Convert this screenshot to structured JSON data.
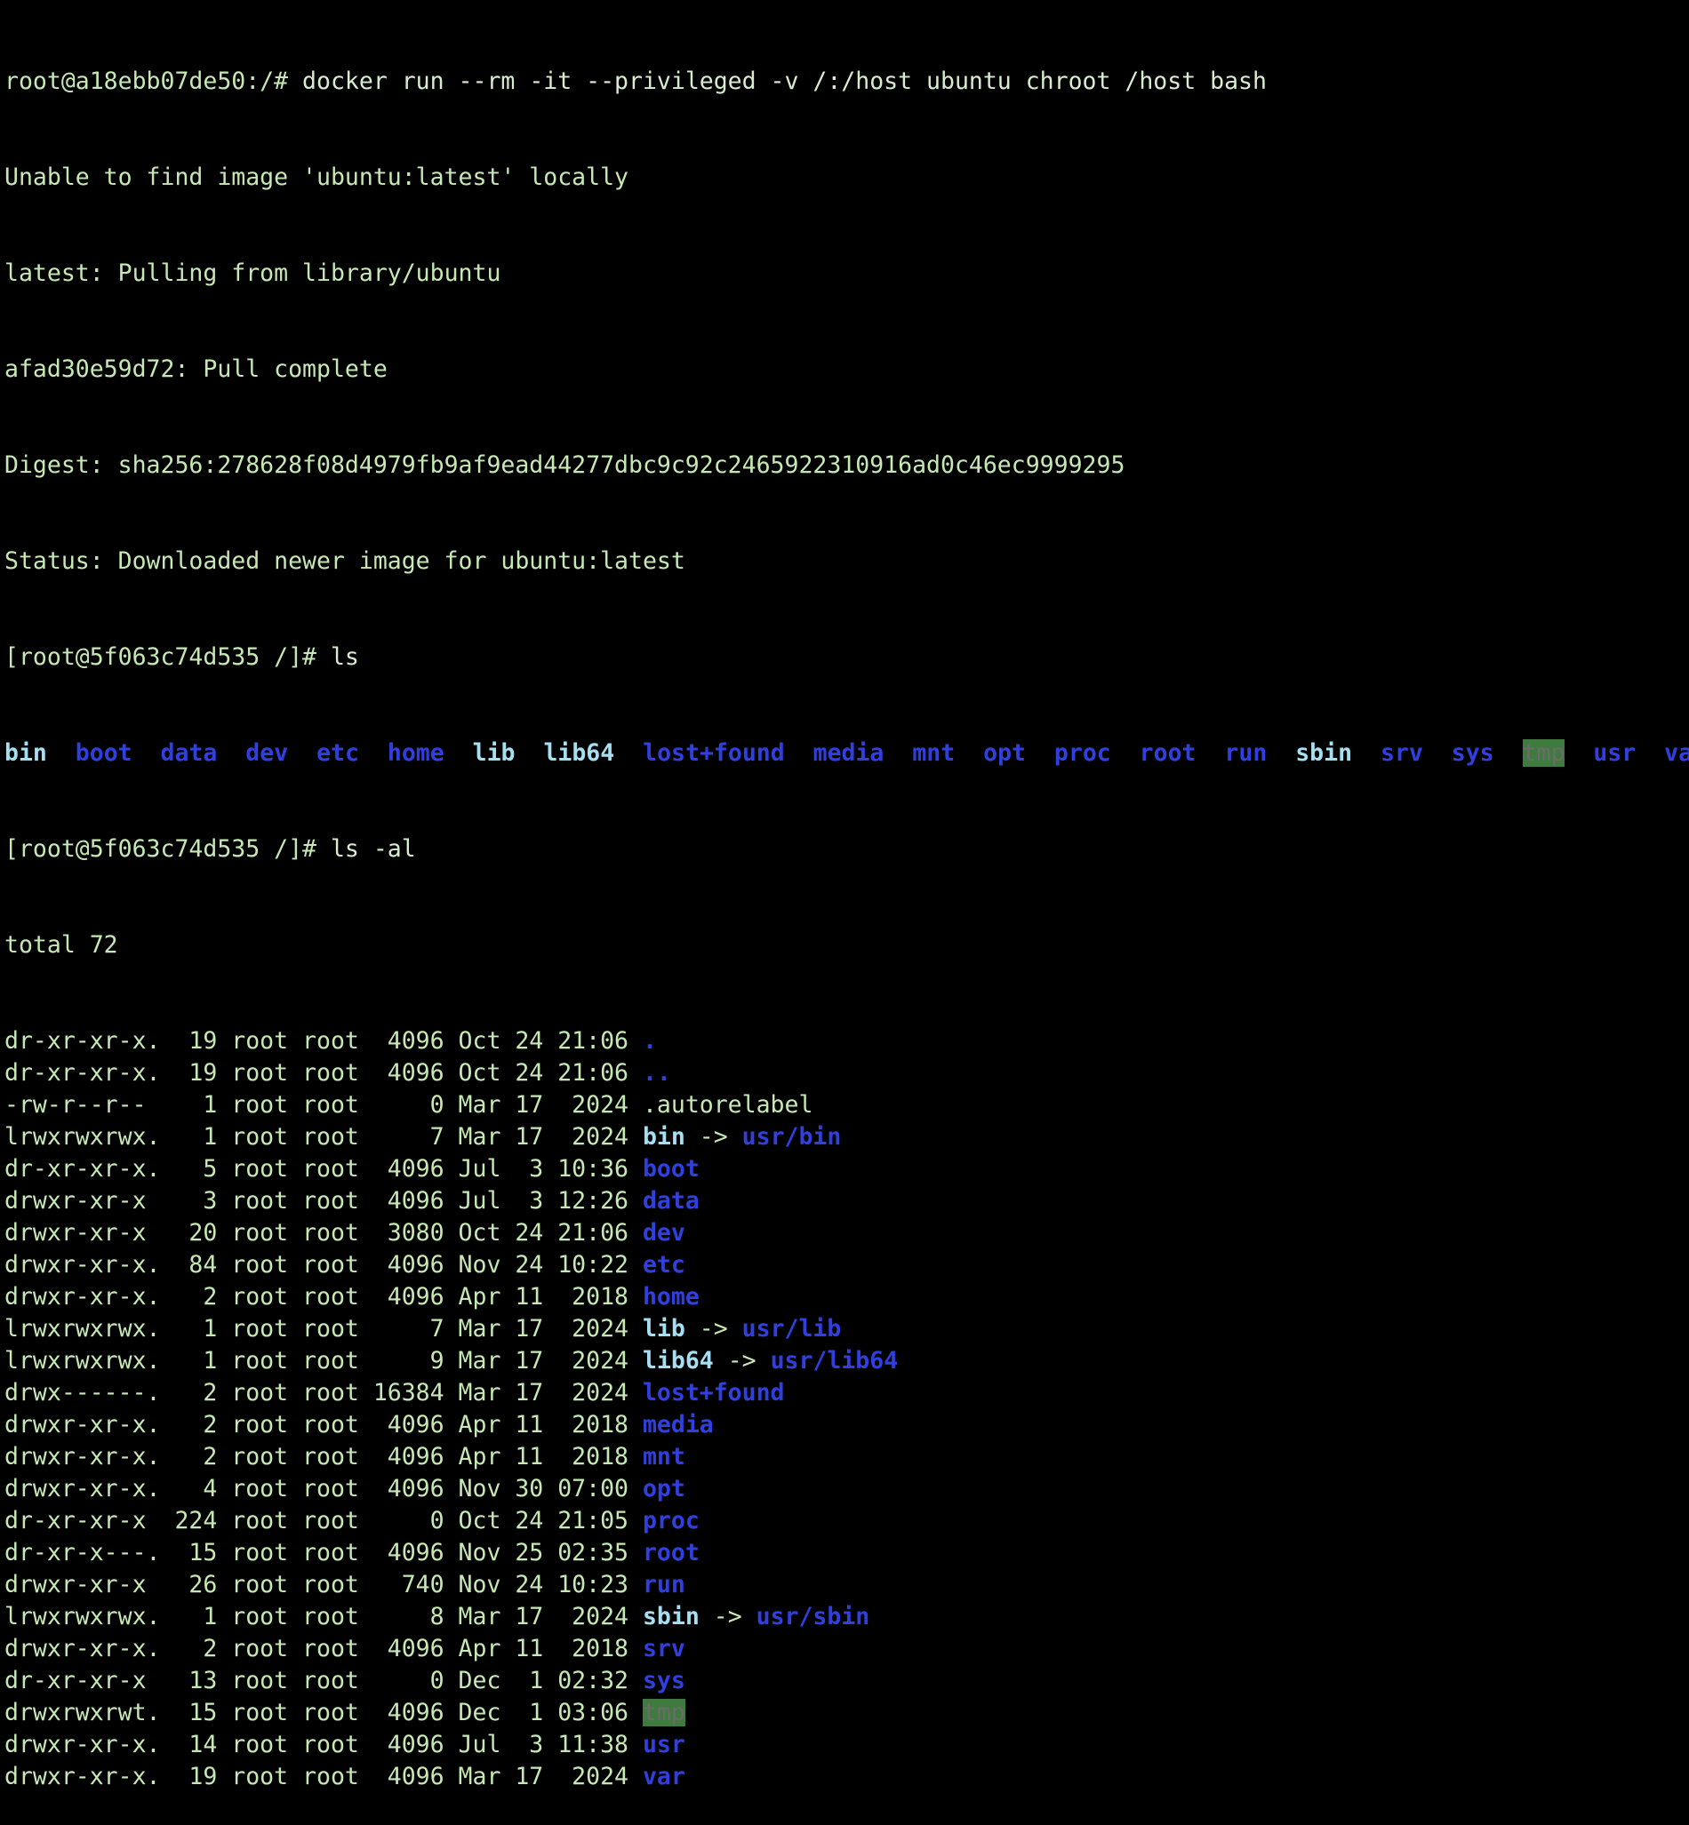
{
  "terminal": {
    "prompt_host": "root@a18ebb07de50:/# ",
    "command_docker": "docker run --rm -it --privileged -v /:/host ubuntu chroot /host bash",
    "output": [
      "Unable to find image 'ubuntu:latest' locally",
      "latest: Pulling from library/ubuntu",
      "afad30e59d72: Pull complete",
      "Digest: sha256:278628f08d4979fb9af9ead44277dbc9c92c2465922310916ad0c46ec9999295",
      "Status: Downloaded newer image for ubuntu:latest"
    ],
    "prompt_chroot": "[root@5f063c74d535 /]# ",
    "command_ls": "ls",
    "command_ls_al": "ls -al",
    "ls_entries": [
      {
        "name": "bin",
        "kind": "link"
      },
      {
        "name": "boot",
        "kind": "dir"
      },
      {
        "name": "data",
        "kind": "dir"
      },
      {
        "name": "dev",
        "kind": "dir"
      },
      {
        "name": "etc",
        "kind": "dir"
      },
      {
        "name": "home",
        "kind": "dir"
      },
      {
        "name": "lib",
        "kind": "link"
      },
      {
        "name": "lib64",
        "kind": "link"
      },
      {
        "name": "lost+found",
        "kind": "dir"
      },
      {
        "name": "media",
        "kind": "dir"
      },
      {
        "name": "mnt",
        "kind": "dir"
      },
      {
        "name": "opt",
        "kind": "dir"
      },
      {
        "name": "proc",
        "kind": "dir"
      },
      {
        "name": "root",
        "kind": "dir"
      },
      {
        "name": "run",
        "kind": "dir"
      },
      {
        "name": "sbin",
        "kind": "link"
      },
      {
        "name": "srv",
        "kind": "dir"
      },
      {
        "name": "sys",
        "kind": "dir"
      },
      {
        "name": "tmp",
        "kind": "sticky"
      },
      {
        "name": "usr",
        "kind": "dir"
      },
      {
        "name": "va",
        "kind": "dir"
      }
    ],
    "total_line": "total 72",
    "ls_al_rows": [
      {
        "meta": "dr-xr-xr-x.  19 root root  4096 Oct 24 21:06 ",
        "name": ".",
        "kind": "dir",
        "target": ""
      },
      {
        "meta": "dr-xr-xr-x.  19 root root  4096 Oct 24 21:06 ",
        "name": "..",
        "kind": "dir",
        "target": ""
      },
      {
        "meta": "-rw-r--r--    1 root root     0 Mar 17  2024 ",
        "name": ".autorelabel",
        "kind": "file",
        "target": ""
      },
      {
        "meta": "lrwxrwxrwx.   1 root root     7 Mar 17  2024 ",
        "name": "bin",
        "kind": "link",
        "target": "usr/bin"
      },
      {
        "meta": "dr-xr-xr-x.   5 root root  4096 Jul  3 10:36 ",
        "name": "boot",
        "kind": "dir",
        "target": ""
      },
      {
        "meta": "drwxr-xr-x    3 root root  4096 Jul  3 12:26 ",
        "name": "data",
        "kind": "dir",
        "target": ""
      },
      {
        "meta": "drwxr-xr-x   20 root root  3080 Oct 24 21:06 ",
        "name": "dev",
        "kind": "dir",
        "target": ""
      },
      {
        "meta": "drwxr-xr-x.  84 root root  4096 Nov 24 10:22 ",
        "name": "etc",
        "kind": "dir",
        "target": ""
      },
      {
        "meta": "drwxr-xr-x.   2 root root  4096 Apr 11  2018 ",
        "name": "home",
        "kind": "dir",
        "target": ""
      },
      {
        "meta": "lrwxrwxrwx.   1 root root     7 Mar 17  2024 ",
        "name": "lib",
        "kind": "link",
        "target": "usr/lib"
      },
      {
        "meta": "lrwxrwxrwx.   1 root root     9 Mar 17  2024 ",
        "name": "lib64",
        "kind": "link",
        "target": "usr/lib64"
      },
      {
        "meta": "drwx------.   2 root root 16384 Mar 17  2024 ",
        "name": "lost+found",
        "kind": "dir",
        "target": ""
      },
      {
        "meta": "drwxr-xr-x.   2 root root  4096 Apr 11  2018 ",
        "name": "media",
        "kind": "dir",
        "target": ""
      },
      {
        "meta": "drwxr-xr-x.   2 root root  4096 Apr 11  2018 ",
        "name": "mnt",
        "kind": "dir",
        "target": ""
      },
      {
        "meta": "drwxr-xr-x.   4 root root  4096 Nov 30 07:00 ",
        "name": "opt",
        "kind": "dir",
        "target": ""
      },
      {
        "meta": "dr-xr-xr-x  224 root root     0 Oct 24 21:05 ",
        "name": "proc",
        "kind": "dir",
        "target": ""
      },
      {
        "meta": "dr-xr-x---.  15 root root  4096 Nov 25 02:35 ",
        "name": "root",
        "kind": "dir",
        "target": ""
      },
      {
        "meta": "drwxr-xr-x   26 root root   740 Nov 24 10:23 ",
        "name": "run",
        "kind": "dir",
        "target": ""
      },
      {
        "meta": "lrwxrwxrwx.   1 root root     8 Mar 17  2024 ",
        "name": "sbin",
        "kind": "link",
        "target": "usr/sbin"
      },
      {
        "meta": "drwxr-xr-x.   2 root root  4096 Apr 11  2018 ",
        "name": "srv",
        "kind": "dir",
        "target": ""
      },
      {
        "meta": "dr-xr-xr-x   13 root root     0 Dec  1 02:32 ",
        "name": "sys",
        "kind": "dir",
        "target": ""
      },
      {
        "meta": "drwxrwxrwt.  15 root root  4096 Dec  1 03:06 ",
        "name": "tmp",
        "kind": "sticky",
        "target": ""
      },
      {
        "meta": "drwxr-xr-x.  14 root root  4096 Jul  3 11:38 ",
        "name": "usr",
        "kind": "dir",
        "target": ""
      },
      {
        "meta": "drwxr-xr-x.  19 root root  4096 Mar 17  2024 ",
        "name": "var",
        "kind": "dir",
        "target": ""
      }
    ],
    "link_arrow": " -> ",
    "colors": {
      "background": "#000000",
      "text": "#c6e9b4",
      "directory": "#2f3fe0",
      "symlink": "#a6dff2",
      "sticky_bg": "#3f7b3f"
    }
  }
}
